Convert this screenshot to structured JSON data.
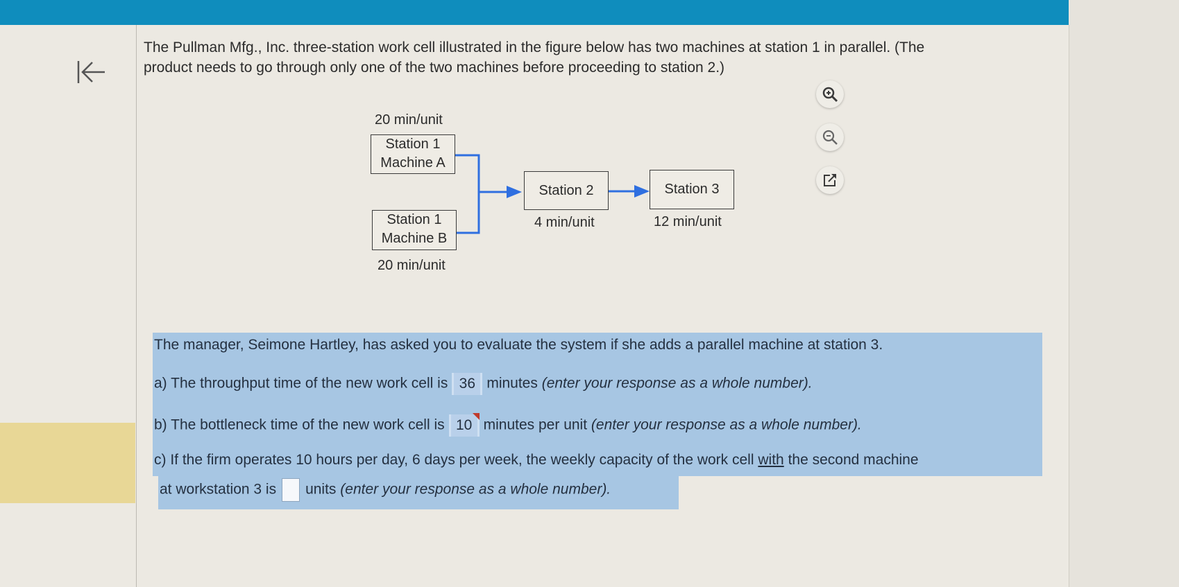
{
  "nav": {
    "back_icon": "collapse-left-arrow-icon"
  },
  "intro": {
    "text": "The Pullman Mfg., Inc. three-station work cell illustrated in the figure below has two machines at station 1 in parallel. (The product needs to go through only one of the two machines before proceeding to station 2.)"
  },
  "diagram": {
    "machine_a": {
      "line1": "Station 1",
      "line2": "Machine A",
      "time": "20 min/unit"
    },
    "machine_b": {
      "line1": "Station 1",
      "line2": "Machine B",
      "time": "20 min/unit"
    },
    "station2": {
      "label": "Station 2",
      "time": "4 min/unit"
    },
    "station3": {
      "label": "Station 3",
      "time": "12 min/unit"
    },
    "arrow_color": "#2f6fe0"
  },
  "tools": {
    "zoom_in": "zoom-in-icon",
    "zoom_out": "zoom-out-icon",
    "popout": "external-link-icon"
  },
  "question": {
    "prompt": "The manager, Seimone Hartley, has asked you to evaluate the system if she adds a parallel machine at station 3.",
    "a": {
      "prefix": "a) The throughput time of the new work cell is",
      "answer": "36",
      "suffix": "minutes",
      "hint": "(enter your response as a whole number)."
    },
    "b": {
      "prefix": "b) The bottleneck time of the new work cell is",
      "answer": "10",
      "suffix": "minutes per unit",
      "hint": "(enter your response as a whole number)."
    },
    "c": {
      "line1_prefix": "c) If the firm operates 10 hours per day, 6 days per week, the weekly capacity of the work cell",
      "line1_underlined": "with",
      "line1_suffix": "the second machine",
      "line2_prefix": "at workstation 3 is",
      "answer": "",
      "suffix": "units",
      "hint": "(enter your response as a whole number)."
    }
  },
  "colors": {
    "topbar": "#0f8dbd",
    "question_highlight": "#a7c6e3",
    "sidebar_highlight": "#e8d796",
    "error_flag": "#c0392b"
  }
}
